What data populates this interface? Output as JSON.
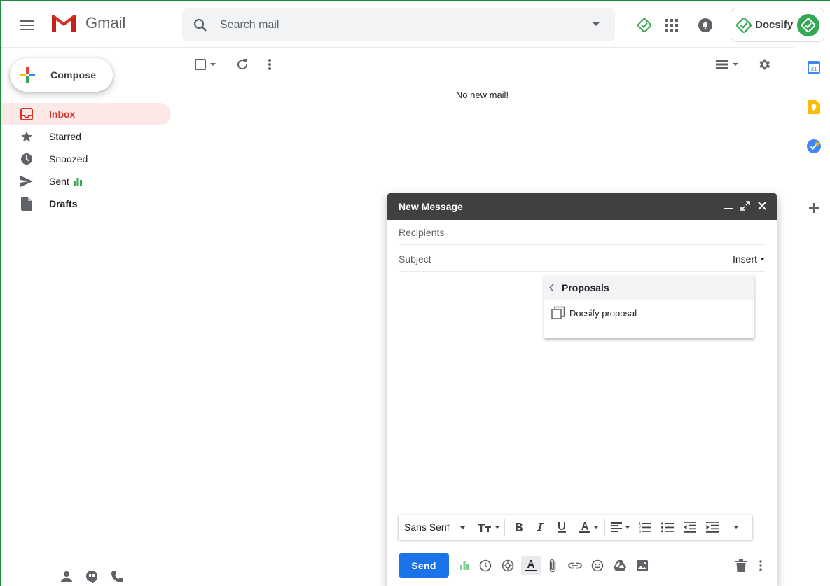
{
  "app": {
    "name": "Gmail"
  },
  "search": {
    "placeholder": "Search mail"
  },
  "header": {
    "docsify_label": "Docsify"
  },
  "sidebar": {
    "compose_label": "Compose",
    "items": [
      {
        "label": "Inbox",
        "icon": "inbox-icon",
        "active": true
      },
      {
        "label": "Starred",
        "icon": "star-icon"
      },
      {
        "label": "Snoozed",
        "icon": "clock-icon"
      },
      {
        "label": "Sent",
        "icon": "send-icon"
      },
      {
        "label": "Drafts",
        "icon": "draft-icon",
        "bold": true
      }
    ]
  },
  "mail_list": {
    "empty_message": "No new mail!"
  },
  "compose_window": {
    "title": "New Message",
    "recipients_placeholder": "Recipients",
    "subject_placeholder": "Subject",
    "insert_label": "Insert",
    "dropdown": {
      "title": "Proposals",
      "items": [
        {
          "label": "Docsify proposal"
        }
      ]
    },
    "format_bar": {
      "font": "Sans Serif"
    },
    "send_label": "Send"
  },
  "colors": {
    "accent_red": "#d93025",
    "send_blue": "#1a73e8",
    "docsify_green": "#34a853",
    "compose_header": "#404040"
  }
}
